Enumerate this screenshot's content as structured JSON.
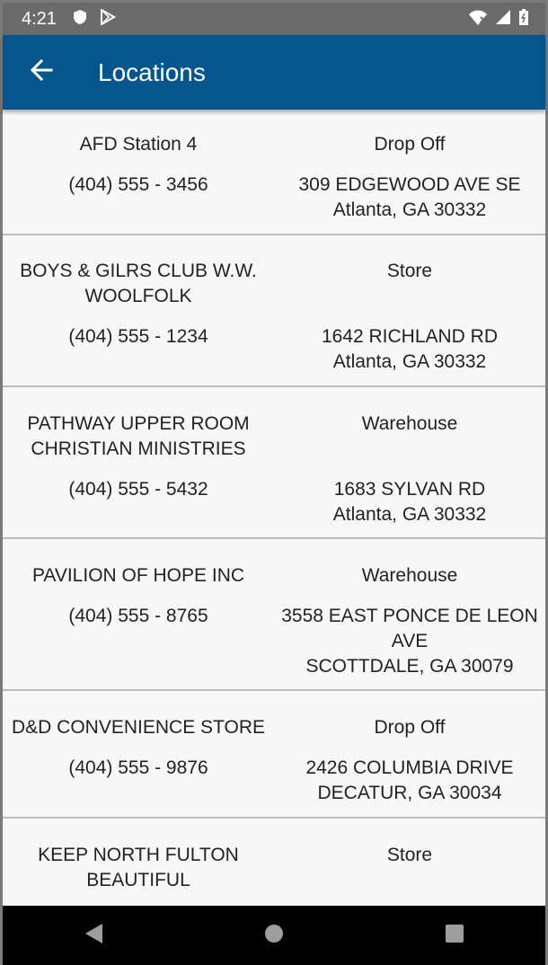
{
  "status": {
    "time": "4:21"
  },
  "app_bar": {
    "title": "Locations"
  },
  "locations": [
    {
      "name_lines": [
        "AFD Station 4"
      ],
      "phone": "(404) 555 - 3456",
      "type": "Drop Off",
      "address_lines": [
        "309 EDGEWOOD AVE SE",
        "Atlanta, GA 30332"
      ]
    },
    {
      "name_lines": [
        "BOYS & GILRS CLUB W.W.",
        "WOOLFOLK"
      ],
      "phone": "(404) 555 - 1234",
      "type": "Store",
      "address_lines": [
        "1642 RICHLAND RD",
        "Atlanta, GA 30332"
      ]
    },
    {
      "name_lines": [
        "PATHWAY UPPER ROOM",
        "CHRISTIAN MINISTRIES"
      ],
      "phone": "(404) 555 - 5432",
      "type": "Warehouse",
      "address_lines": [
        "1683 SYLVAN RD",
        "Atlanta, GA 30332"
      ]
    },
    {
      "name_lines": [
        "PAVILION OF HOPE INC"
      ],
      "phone": "(404) 555 - 8765",
      "type": "Warehouse",
      "address_lines": [
        "3558 EAST PONCE DE LEON",
        "AVE",
        "SCOTTDALE, GA 30079"
      ]
    },
    {
      "name_lines": [
        "D&D CONVENIENCE STORE"
      ],
      "phone": "(404) 555 - 9876",
      "type": "Drop Off",
      "address_lines": [
        "2426 COLUMBIA DRIVE",
        "DECATUR, GA 30034"
      ]
    },
    {
      "name_lines": [
        "KEEP NORTH FULTON",
        "BEAUTIFUL"
      ],
      "phone": "",
      "type": "Store",
      "address_lines": []
    }
  ]
}
